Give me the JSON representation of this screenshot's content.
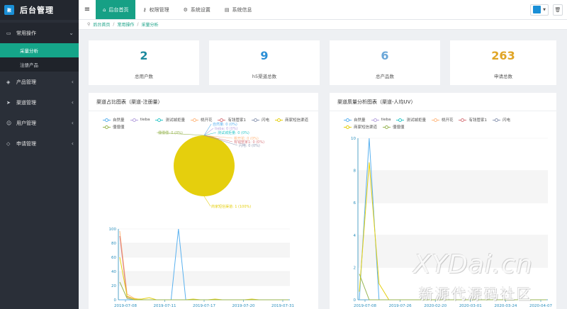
{
  "app": {
    "title": "后台管理",
    "logo_text": "聚"
  },
  "sidebar": {
    "groups": [
      {
        "label": "常用操作",
        "icon": "folder-icon",
        "open": true,
        "children": [
          {
            "label": "采量分析",
            "active": true
          },
          {
            "label": "注册产品",
            "active": false
          }
        ]
      },
      {
        "label": "产品管理",
        "icon": "cube-icon"
      },
      {
        "label": "渠道管理",
        "icon": "send-icon"
      },
      {
        "label": "用户管理",
        "icon": "user-icon"
      },
      {
        "label": "申请管理",
        "icon": "tag-icon"
      }
    ]
  },
  "topbar": {
    "tabs": [
      {
        "label": "后台首页",
        "icon": "home-icon",
        "active": true
      },
      {
        "label": "权限管理",
        "icon": "key-icon"
      },
      {
        "label": "系统设置",
        "icon": "gear-icon"
      },
      {
        "label": "系统信息",
        "icon": "doc-icon"
      }
    ]
  },
  "breadcrumb": [
    "后台首页",
    "常用操作",
    "采量分析"
  ],
  "stats": [
    {
      "value": "2",
      "label": "总用户数",
      "color": "#1d8a9e"
    },
    {
      "value": "9",
      "label": "h5渠道总数",
      "color": "#2b8fd6"
    },
    {
      "value": "6",
      "label": "总产品数",
      "color": "#6aa7d8"
    },
    {
      "value": "263",
      "label": "申请总数",
      "color": "#e0a526"
    }
  ],
  "legend_items": [
    {
      "name": "自然量",
      "color": "#5ab1ef"
    },
    {
      "name": "tieba",
      "color": "#b6a2de"
    },
    {
      "name": "测试城拒量",
      "color": "#2ec7c9"
    },
    {
      "name": "桃开花",
      "color": "#ffb980"
    },
    {
      "name": "有钱管家1",
      "color": "#d87a80"
    },
    {
      "name": "闪电",
      "color": "#8d98b3"
    },
    {
      "name": "商家短信渠道",
      "color": "#e5cf0d"
    },
    {
      "name": "僵僵僵",
      "color": "#97b552"
    }
  ],
  "chart_data": [
    {
      "type": "pie",
      "title": "渠道占比图表（渠道-注册量）",
      "slices": [
        {
          "name": "自然量",
          "value": 0,
          "label": "自然量: 0 (0%)"
        },
        {
          "name": "tieba",
          "value": 0,
          "label": "tieba: 0 (0%)"
        },
        {
          "name": "测试城拒量",
          "value": 0,
          "label": "测试城拒量: 0 (0%)"
        },
        {
          "name": "桃开花",
          "value": 0,
          "label": "桃开花: 0 (0%)"
        },
        {
          "name": "有钱管家1",
          "value": 0,
          "label": "有钱管家1: 0 (0%)"
        },
        {
          "name": "闪电",
          "value": 0,
          "label": "闪电: 0 (0%)"
        },
        {
          "name": "僵僵僵",
          "value": 0,
          "label": "僵僵僵: 0 (0%)"
        },
        {
          "name": "商家短信渠道",
          "value": 1,
          "label": "商家短信渠道: 1 (100%)"
        }
      ]
    },
    {
      "type": "line",
      "title": "",
      "x_ticks": [
        "2019-07-08",
        "2019-07-11",
        "2019-07-17",
        "2019-07-20",
        "2019-07-31"
      ],
      "ylim": [
        0,
        100
      ],
      "y_ticks": [
        0,
        20,
        40,
        60,
        80,
        100
      ],
      "series": [
        {
          "name": "自然量",
          "values": [
            0,
            0,
            0,
            0,
            0,
            0,
            0,
            0,
            100,
            0,
            0,
            0,
            0,
            0,
            0,
            0,
            0,
            0,
            0,
            0,
            0,
            0,
            0,
            0
          ]
        },
        {
          "name": "桃开花",
          "values": [
            97,
            8,
            2,
            0,
            0,
            0,
            0,
            0,
            0,
            0,
            0,
            0,
            0,
            0,
            0,
            0,
            0,
            0,
            0,
            0,
            0,
            0,
            0,
            0
          ]
        },
        {
          "name": "有钱管家1",
          "values": [
            90,
            4,
            1,
            0,
            0,
            0,
            0,
            0,
            0,
            0,
            0,
            0,
            0,
            0,
            0,
            0,
            0,
            0,
            0,
            0,
            0,
            0,
            0,
            0
          ]
        },
        {
          "name": "商家短信渠道",
          "values": [
            60,
            5,
            1,
            1,
            3,
            0,
            0,
            0,
            0,
            0,
            1,
            0,
            0,
            1,
            0,
            0,
            0,
            0,
            1,
            0,
            0,
            0,
            0,
            0
          ]
        },
        {
          "name": "僵僵僵",
          "values": [
            25,
            2,
            0,
            0,
            0,
            0,
            0,
            0,
            0,
            0,
            0,
            0,
            0,
            0,
            0,
            0,
            0,
            0,
            0,
            0,
            0,
            0,
            0,
            0
          ]
        }
      ]
    },
    {
      "type": "line",
      "title": "渠道质量分析图表（渠道-人均UV）",
      "x_ticks": [
        "2019-07-08",
        "2019-07-26",
        "2020-02-20",
        "2020-03-01",
        "2020-03-24",
        "2020-04-07"
      ],
      "ylim": [
        0,
        10
      ],
      "y_ticks": [
        0,
        2,
        4,
        6,
        8,
        10
      ],
      "series": [
        {
          "name": "自然量",
          "values": [
            0,
            10,
            0,
            0,
            0,
            0,
            0,
            0,
            0,
            0,
            0,
            0,
            0,
            0,
            0,
            0,
            0,
            0,
            0,
            0
          ]
        },
        {
          "name": "商家短信渠道",
          "values": [
            0.5,
            8.5,
            1,
            0,
            0,
            0,
            0,
            0,
            0,
            0,
            0,
            0,
            0,
            0,
            0,
            0,
            0,
            0,
            0,
            0
          ]
        },
        {
          "name": "僵僵僵",
          "values": [
            1.6,
            0,
            0,
            0,
            0,
            0,
            0,
            0,
            0,
            0,
            0,
            0,
            0,
            0,
            0,
            0,
            0,
            0,
            0,
            0
          ]
        }
      ]
    }
  ],
  "watermark": {
    "line1": "XYDai.cn",
    "line2": "新源代源码社区"
  }
}
